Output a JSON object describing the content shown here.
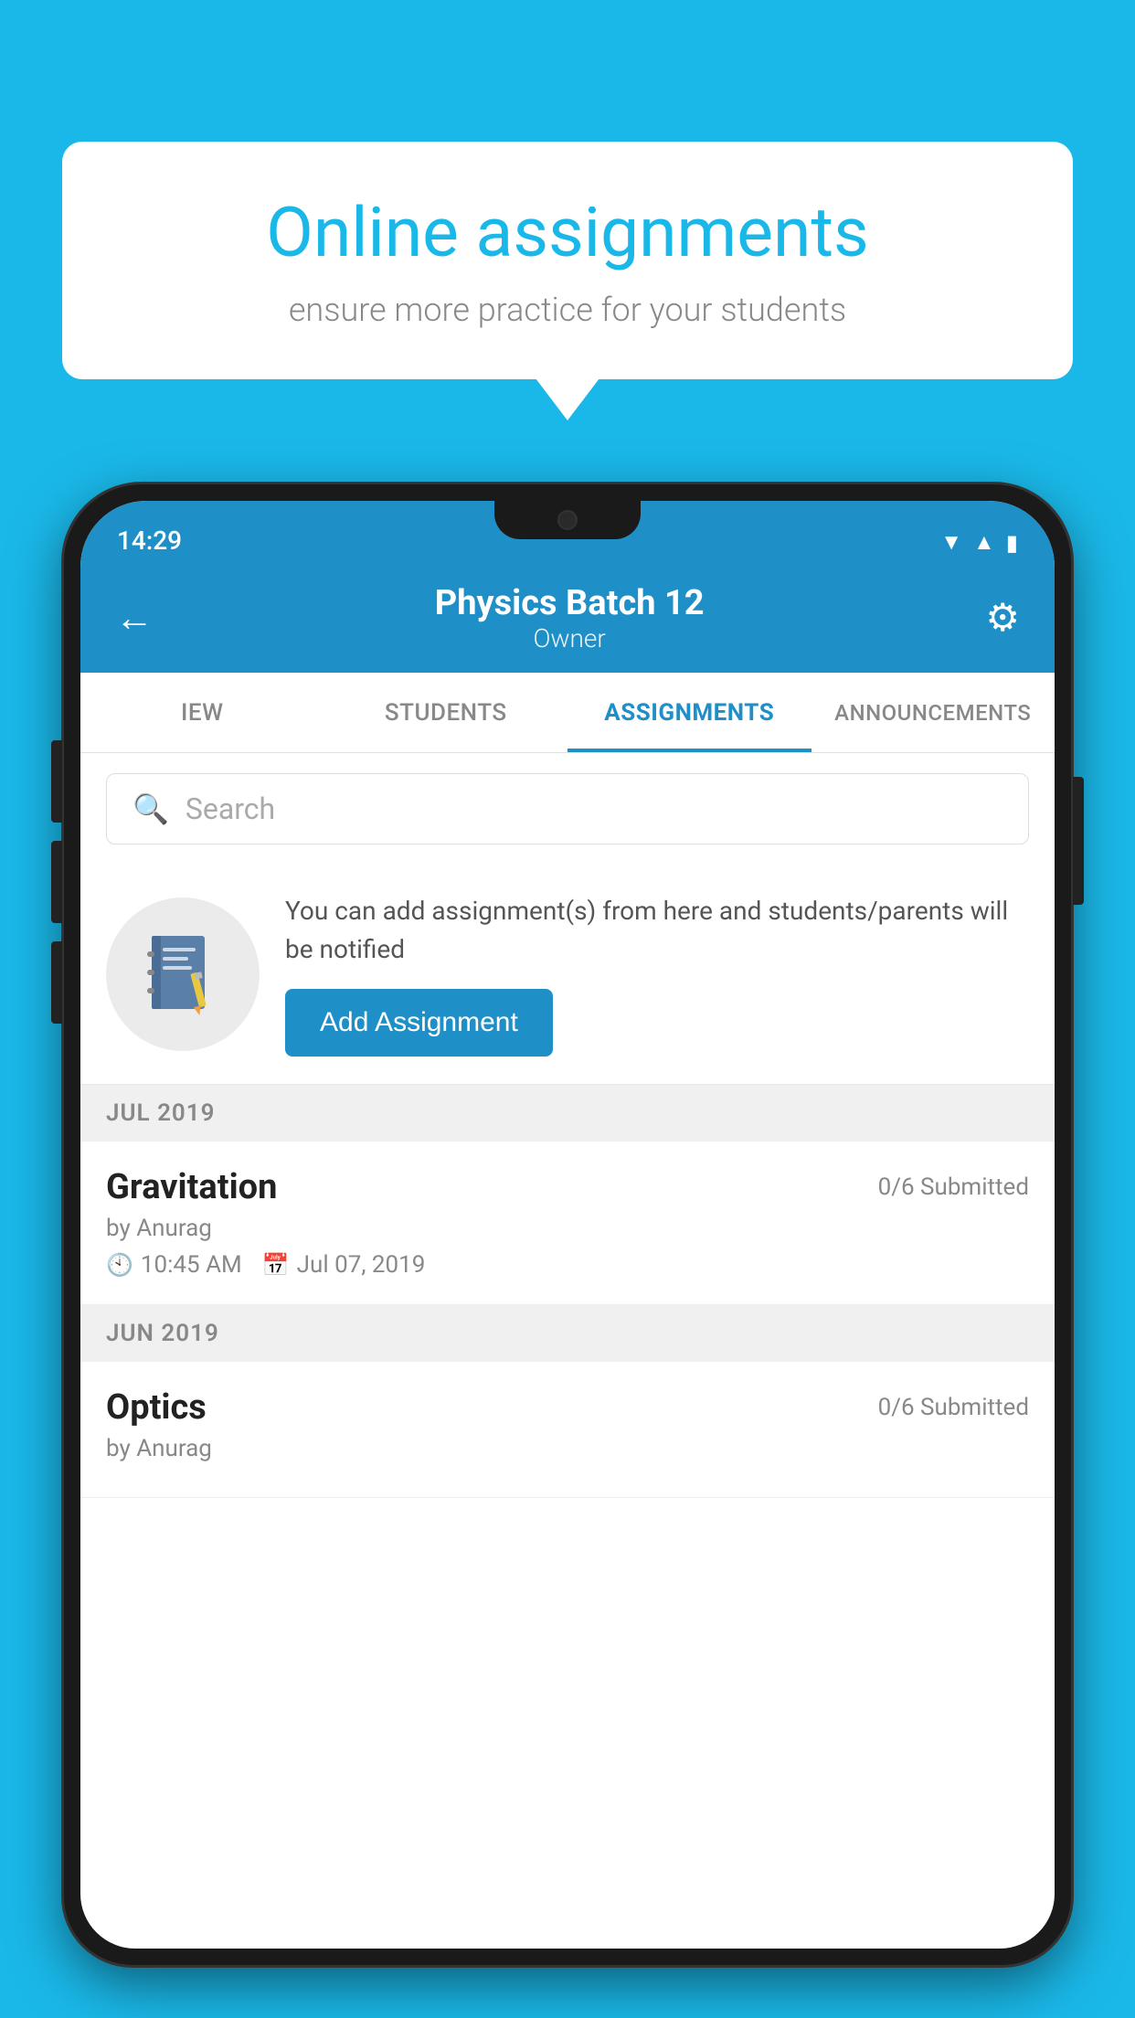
{
  "background_color": "#1ab8e8",
  "speech_bubble": {
    "title": "Online assignments",
    "subtitle": "ensure more practice for your students"
  },
  "status_bar": {
    "time": "14:29",
    "wifi": "▼",
    "signal": "▲",
    "battery": "▮"
  },
  "header": {
    "title": "Physics Batch 12",
    "subtitle": "Owner",
    "back_label": "←",
    "settings_label": "⚙"
  },
  "tabs": [
    {
      "id": "view",
      "label": "IEW",
      "active": false
    },
    {
      "id": "students",
      "label": "STUDENTS",
      "active": false
    },
    {
      "id": "assignments",
      "label": "ASSIGNMENTS",
      "active": true
    },
    {
      "id": "announcements",
      "label": "ANNOUNCEMENTS",
      "active": false
    }
  ],
  "search": {
    "placeholder": "Search"
  },
  "info_card": {
    "description": "You can add assignment(s) from here and students/parents will be notified",
    "button_label": "Add Assignment"
  },
  "assignment_groups": [
    {
      "month": "JUL 2019",
      "assignments": [
        {
          "name": "Gravitation",
          "submitted": "0/6 Submitted",
          "by": "by Anurag",
          "time": "10:45 AM",
          "date": "Jul 07, 2019"
        }
      ]
    },
    {
      "month": "JUN 2019",
      "assignments": [
        {
          "name": "Optics",
          "submitted": "0/6 Submitted",
          "by": "by Anurag",
          "time": "",
          "date": ""
        }
      ]
    }
  ]
}
